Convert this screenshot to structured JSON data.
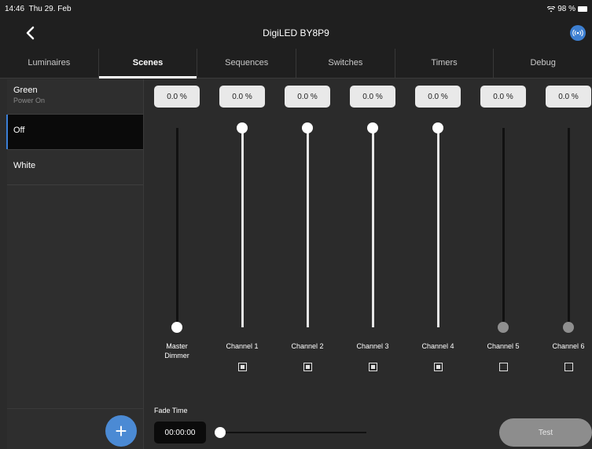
{
  "status_bar": {
    "time": "14:46",
    "date": "Thu 29. Feb",
    "battery": "98 %"
  },
  "header": {
    "title": "DigiLED BY8P9",
    "back_icon": "chevron-left-icon",
    "device_icon": "broadcast-icon"
  },
  "tabs": [
    {
      "label": "Luminaires",
      "active": false
    },
    {
      "label": "Scenes",
      "active": true
    },
    {
      "label": "Sequences",
      "active": false
    },
    {
      "label": "Switches",
      "active": false
    },
    {
      "label": "Timers",
      "active": false
    },
    {
      "label": "Debug",
      "active": false
    }
  ],
  "scenes": [
    {
      "name": "Green",
      "subtitle": "Power On",
      "active": false
    },
    {
      "name": "Off",
      "subtitle": "",
      "active": true
    },
    {
      "name": "White",
      "subtitle": "",
      "active": false
    }
  ],
  "add_button": {
    "symbol": "+"
  },
  "channels": [
    {
      "label": "Master Dimmer",
      "percent": "0.0 %",
      "level": 0,
      "checkbox": null
    },
    {
      "label": "Channel 1",
      "percent": "0.0 %",
      "level": 1,
      "checkbox": true
    },
    {
      "label": "Channel 2",
      "percent": "0.0 %",
      "level": 1,
      "checkbox": true
    },
    {
      "label": "Channel 3",
      "percent": "0.0 %",
      "level": 1,
      "checkbox": true
    },
    {
      "label": "Channel 4",
      "percent": "0.0 %",
      "level": 1,
      "checkbox": true
    },
    {
      "label": "Channel 5",
      "percent": "0.0 %",
      "level": 0,
      "checkbox": false
    },
    {
      "label": "Channel 6",
      "percent": "0.0 %",
      "level": 0,
      "checkbox": false
    }
  ],
  "fade": {
    "label": "Fade Time",
    "value": "00:00:00",
    "level": 0
  },
  "test_button": {
    "label": "Test"
  },
  "colors": {
    "accent": "#3b7fd6",
    "background": "#2b2b2b",
    "bar": "#1f1f1f"
  }
}
